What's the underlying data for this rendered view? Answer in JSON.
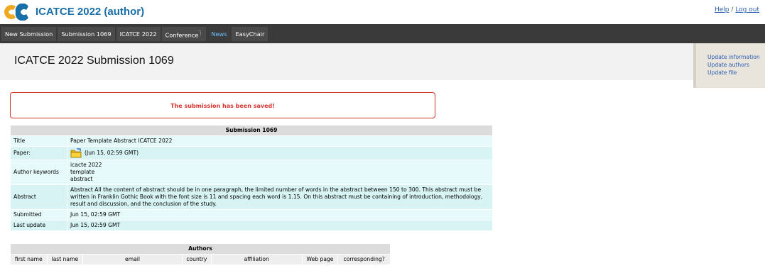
{
  "header": {
    "app_title": "ICATCE 2022 (author)",
    "help": "Help",
    "separator": "/",
    "logout": "Log out"
  },
  "menu": {
    "items": [
      "New Submission",
      "Submission 1069",
      "ICATCE 2022",
      "Conference",
      "News",
      "EasyChair"
    ],
    "active_index": 4
  },
  "page": {
    "title": "ICATCE 2022 Submission 1069"
  },
  "side": {
    "links": [
      "Update information",
      "Update authors",
      "Update file"
    ]
  },
  "message": "The submission has been saved!",
  "submission": {
    "caption": "Submission 1069",
    "title_label": "Title",
    "title_value": "Paper Template Abstract ICATCE 2022",
    "paper_label": "Paper:",
    "paper_date": "(Jun 15, 02:59 GMT)",
    "keywords_label": "Author keywords",
    "keywords": [
      "icacte 2022",
      "template",
      "abstract"
    ],
    "abstract_label": "Abstract",
    "abstract_text": "Abstract All the content of abstract should be in one paragraph, the limited number of words in the abstract between 150 to 300. This abstract must be written in Franklin Gothic Book with the font size is 11 and spacing each word is 1.15. On this abstract must be containing of introduction, methodology, result and discussion, and the conclusion of the study.",
    "submitted_label": "Submitted",
    "submitted_value": "Jun 15, 02:59 GMT",
    "lastupdate_label": "Last update",
    "lastupdate_value": "Jun 15, 02:59 GMT"
  },
  "authors": {
    "caption": "Authors",
    "columns": [
      "first name",
      "last name",
      "email",
      "country",
      "affiliation",
      "Web page",
      "corresponding?"
    ]
  },
  "colors": {
    "brand": "#1a6fa8",
    "menubar": "#3a3a3a",
    "active_menu_text": "#6ac3ff",
    "message": "#d4322f",
    "row_light": "#e6fafb",
    "row_dark": "#d7f3f4"
  }
}
